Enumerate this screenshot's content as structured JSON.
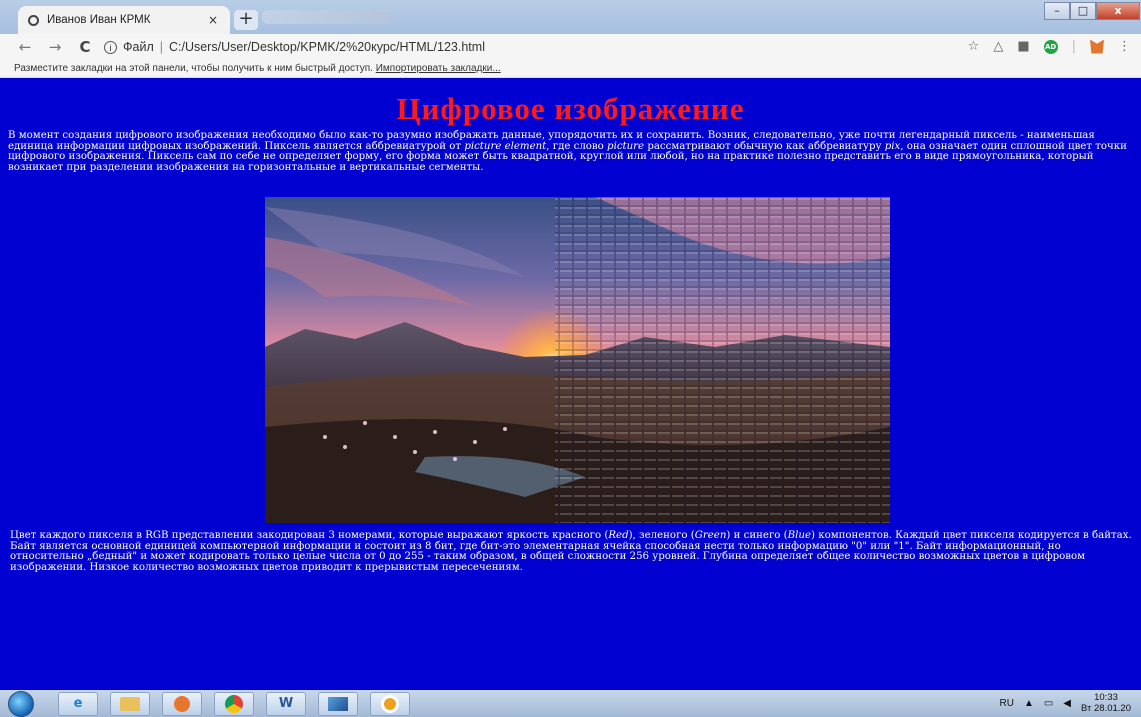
{
  "browser": {
    "tab": {
      "title": "Иванов Иван КРМК",
      "close_glyph": "×"
    },
    "new_tab_glyph": "+",
    "window_buttons": {
      "minimize": "–",
      "maximize": "□",
      "close": "x"
    },
    "nav": {
      "back": "←",
      "forward": "→",
      "reload": "C"
    },
    "address": {
      "info_glyph": "i",
      "scheme_label": "Файл",
      "separator": "|",
      "url": "C:/Users/User/Desktop/KPMK/2%20курс/HTML/123.html"
    },
    "toolbar_icons": [
      "star-icon",
      "drive-icon",
      "camera-icon",
      "adblock-icon",
      "fox-icon",
      "menu-icon"
    ],
    "adblock_label": "AD",
    "bookmarks": {
      "prompt": "Разместите закладки на этой панели, чтобы получить к ним быстрый доступ.",
      "import_link": "Импортировать закладки..."
    }
  },
  "page": {
    "title": "Цифровое изображение",
    "paragraph1": [
      {
        "t": "В момент создания цифрового изображения необходимо было как-то разумно изображать данные, упорядочить их и сохранить. Возник, следовательно, уже почти легендарный пиксель - наименьшая единица информации цифровых изображений. Пиксель является аббревиатурой от "
      },
      {
        "t": "picture element",
        "i": true
      },
      {
        "t": ", где слово "
      },
      {
        "t": "picture",
        "i": true
      },
      {
        "t": " рассматривают обычную как аббревиатуру "
      },
      {
        "t": "pix",
        "i": true
      },
      {
        "t": ", она означает один сплошной цвет точки цифрового изображения. Пиксель сам по себе не определяет форму, его форма может быть квадратной, круглой или любой, но на практике полезно представить его в виде прямоугольника, который возникает при разделении изображения на горизонтальные и вертикальные сегменты."
      }
    ],
    "paragraph2": [
      {
        "t": "Цвет каждого пикселя в RGB представлении закодирован 3 номерами, которые выражают яркость красного ("
      },
      {
        "t": "Red",
        "i": true
      },
      {
        "t": "), зеленого ("
      },
      {
        "t": "Green",
        "i": true
      },
      {
        "t": ") и синего ("
      },
      {
        "t": "Blue",
        "i": true
      },
      {
        "t": ") компонентов. Каждый цвет пикселя кодируется в байтах. Байт является основной единицей компьютерной информации и состоит из 8 бит, где бит-это элементарная ячейка способная нести только информацию \"0\" или \"1\". Байт информационный, но относительно „бедный\" и может кодировать только целые числа от 0 до 255 - таким образом, в общей сложности 256 уровней. Глубина определяет общее количество возможных цветов в цифровом изображении. Низкое количество возможных цветов приводит к прерывистым пересечениям."
      }
    ],
    "colors": {
      "background": "#0000d0",
      "title": "#ff1a1a",
      "text": "#ffffff"
    }
  },
  "taskbar": {
    "apps": [
      "ie-icon",
      "explorer-icon",
      "media-player-icon",
      "chrome-icon",
      "word-icon",
      "app-icon",
      "chrome-canary-icon"
    ],
    "word_label": "W",
    "tray": {
      "language": "RU",
      "time": "10:33",
      "date": "Вт 28.01.20"
    }
  }
}
